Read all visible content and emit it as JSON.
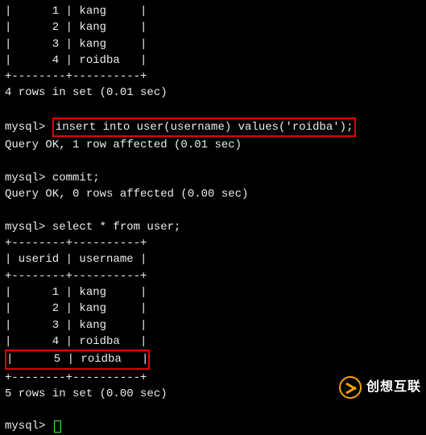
{
  "top_rows": [
    "|      1 | kang     |",
    "|      2 | kang     |",
    "|      3 | kang     |",
    "|      4 | roidba   |",
    "+--------+----------+"
  ],
  "top_summary": "4 rows in set (0.01 sec)",
  "prompt": "mysql> ",
  "insert_stmt": "insert into user(username) values('roidba');",
  "insert_result": "Query OK, 1 row affected (0.01 sec)",
  "commit_stmt": "commit;",
  "commit_result": "Query OK, 0 rows affected (0.00 sec)",
  "select_stmt": "select * from user;",
  "select_border": "+--------+----------+",
  "select_header": "| userid | username |",
  "select_rows": [
    "|      1 | kang     |",
    "|      2 | kang     |",
    "|      3 | kang     |",
    "|      4 | roidba   |"
  ],
  "select_highlight_row": "|      5 | roidba   |",
  "select_summary": "5 rows in set (0.00 sec)",
  "watermark_text": "创想互联"
}
